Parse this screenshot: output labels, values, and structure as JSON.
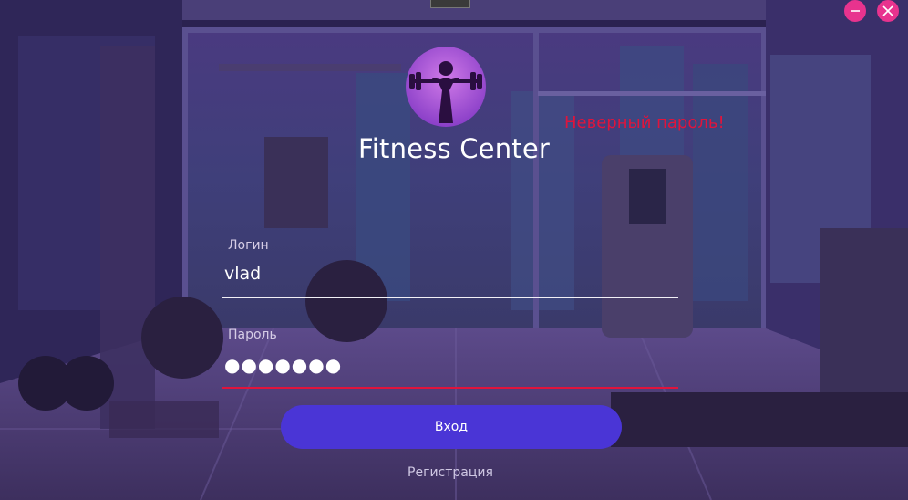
{
  "app": {
    "title": "Fitness Center"
  },
  "window_controls": {
    "minimize_icon": "minimize-icon",
    "close_icon": "close-icon",
    "accent": "#e8338e"
  },
  "error": {
    "message": "Неверный пароль!",
    "color": "#e0143c"
  },
  "form": {
    "login": {
      "label": "Логин",
      "value": "vlad"
    },
    "password": {
      "label": "Пароль",
      "masked_value": "●●●●●●●"
    },
    "submit_label": "Вход",
    "register_label": "Регистрация"
  },
  "colors": {
    "button": "#4a35d6",
    "logo": "#a64bd6"
  }
}
